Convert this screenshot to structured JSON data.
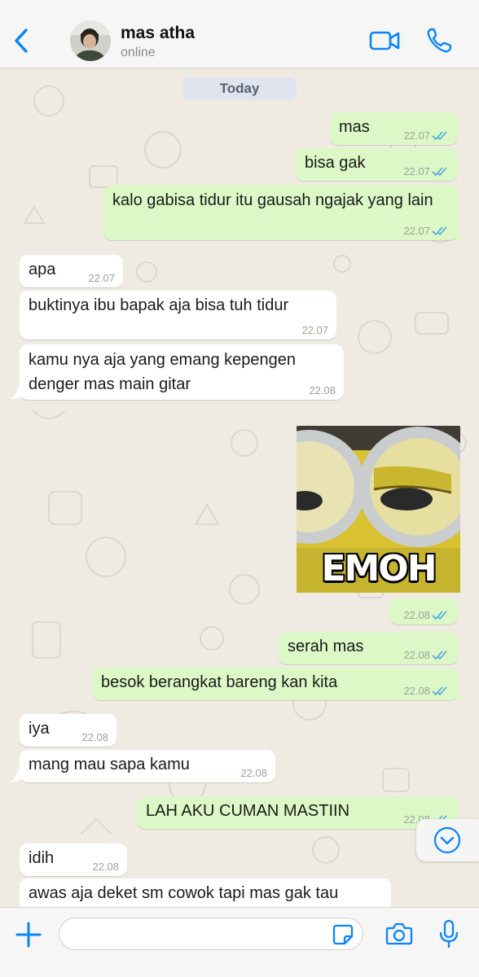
{
  "header": {
    "contact_name": "mas atha",
    "status": "online"
  },
  "chat": {
    "date_label": "Today",
    "messages": [
      {
        "dir": "out",
        "text": "mas",
        "time": "22.07",
        "ticks": "read"
      },
      {
        "dir": "out",
        "text": "bisa gak",
        "time": "22.07",
        "ticks": "read"
      },
      {
        "dir": "out",
        "text": "kalo gabisa tidur itu gausah ngajak yang lain",
        "time": "22.07",
        "ticks": "read"
      },
      {
        "dir": "in",
        "text": "apa",
        "time": "22.07"
      },
      {
        "dir": "in",
        "text": "buktinya ibu bapak aja bisa tuh tidur",
        "time": "22.07"
      },
      {
        "dir": "in",
        "text": "kamu nya aja yang emang kepengen denger mas main gitar",
        "time": "22.08"
      },
      {
        "dir": "out",
        "type": "image",
        "caption_in_image": "EMOH",
        "time": "22.08",
        "ticks": "read"
      },
      {
        "dir": "out",
        "text": "serah mas",
        "time": "22.08",
        "ticks": "read"
      },
      {
        "dir": "out",
        "text": "besok berangkat bareng kan kita",
        "time": "22.08",
        "ticks": "read"
      },
      {
        "dir": "in",
        "text": "iya",
        "time": "22.08"
      },
      {
        "dir": "in",
        "text": "mang mau sapa kamu",
        "time": "22.08"
      },
      {
        "dir": "out",
        "text": "LAH AKU CUMAN MASTIIN",
        "time": "22.08",
        "ticks": "read"
      },
      {
        "dir": "in",
        "text": "idih",
        "time": "22.08"
      },
      {
        "dir": "in",
        "text": "awas aja deket sm cowok tapi mas gak tau",
        "time": ""
      }
    ]
  },
  "input": {
    "placeholder": ""
  },
  "icons": {
    "back": "chevron-left-icon",
    "video": "video-camera-icon",
    "call": "phone-icon",
    "scroll_down": "chevron-down-circle-icon",
    "plus": "plus-icon",
    "sticker": "sticker-icon",
    "camera": "camera-icon",
    "mic": "microphone-icon"
  },
  "colors": {
    "accent": "#0a84ff",
    "outgoing_bubble": "#dcf8c6",
    "incoming_bubble": "#ffffff",
    "read_ticks": "#4fa3e0",
    "chat_background": "#efeae2"
  }
}
